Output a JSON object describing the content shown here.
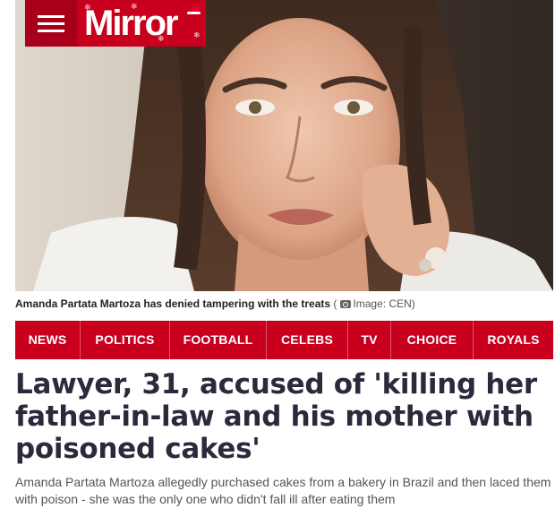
{
  "brand": {
    "name": "Mirror",
    "accent_color": "#c8001e",
    "menu_icon": "hamburger-icon"
  },
  "photo": {
    "caption": "Amanda Partata Martoza has denied tampering with the treats",
    "credit_icon": "camera-icon",
    "credit": "Image: CEN"
  },
  "nav": {
    "items": [
      {
        "label": "NEWS"
      },
      {
        "label": "POLITICS"
      },
      {
        "label": "FOOTBALL"
      },
      {
        "label": "CELEBS"
      },
      {
        "label": "TV"
      },
      {
        "label": "CHOICE"
      },
      {
        "label": "ROYALS"
      }
    ]
  },
  "article": {
    "headline": "Lawyer, 31, accused of 'killing her father-in-law and his mother with poisoned cakes'",
    "standfirst": "Amanda Partata Martoza allegedly purchased cakes from a bakery in Brazil and then laced them with poison - she was the only one who didn't fall ill after eating them"
  }
}
